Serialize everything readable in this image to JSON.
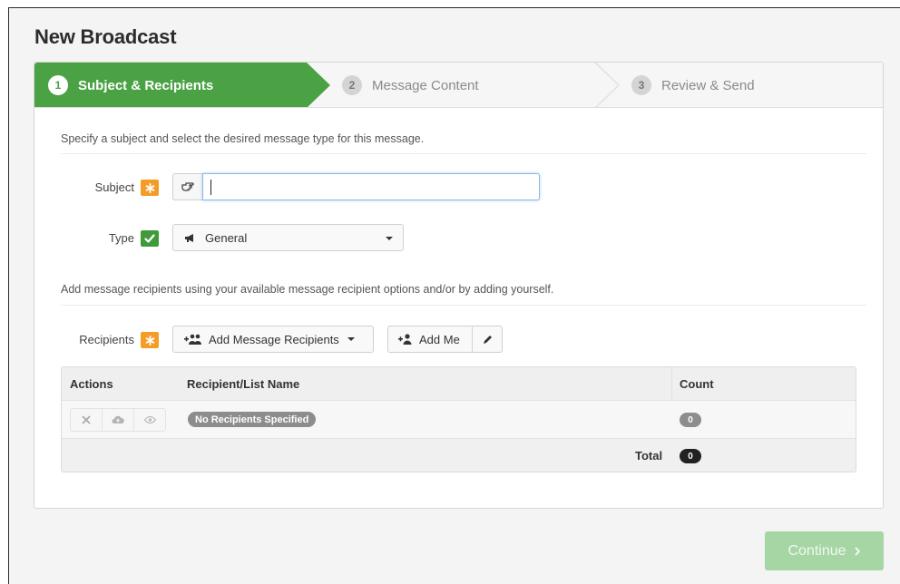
{
  "page": {
    "title": "New Broadcast"
  },
  "wizard": {
    "steps": [
      {
        "number": "1",
        "label": "Subject & Recipients",
        "state": "active"
      },
      {
        "number": "2",
        "label": "Message Content",
        "state": "inactive"
      },
      {
        "number": "3",
        "label": "Review & Send",
        "state": "inactive"
      }
    ],
    "active_color": "#4aa244"
  },
  "subject_section": {
    "hint": "Specify a subject and select the desired message type for this message.",
    "subject_label": "Subject",
    "subject_value": "",
    "type_label": "Type",
    "type_value": "General"
  },
  "recipients_section": {
    "hint": "Add message recipients using your available message recipient options and/or by adding yourself.",
    "label": "Recipients",
    "add_recipients_label": "Add Message Recipients",
    "add_me_label": "Add Me"
  },
  "table": {
    "headers": {
      "actions": "Actions",
      "name": "Recipient/List Name",
      "count": "Count"
    },
    "rows": [
      {
        "name": "No Recipients Specified",
        "count": "0"
      }
    ],
    "total_label": "Total",
    "total_value": "0"
  },
  "footer": {
    "continue_label": "Continue"
  },
  "icons": {
    "required": "asterisk-icon",
    "valid": "check-icon",
    "subject": "hand-pointer-icon",
    "type": "megaphone-icon",
    "add_recipients": "users-plus-icon",
    "add_me": "user-plus-icon",
    "edit": "pencil-icon",
    "remove": "close-icon",
    "upload": "cloud-upload-icon",
    "view": "eye-icon",
    "continue": "chevron-right-icon"
  },
  "colors": {
    "required": "#f39c26",
    "valid": "#3f9a3c",
    "continue_disabled": "#a7d6a5"
  }
}
